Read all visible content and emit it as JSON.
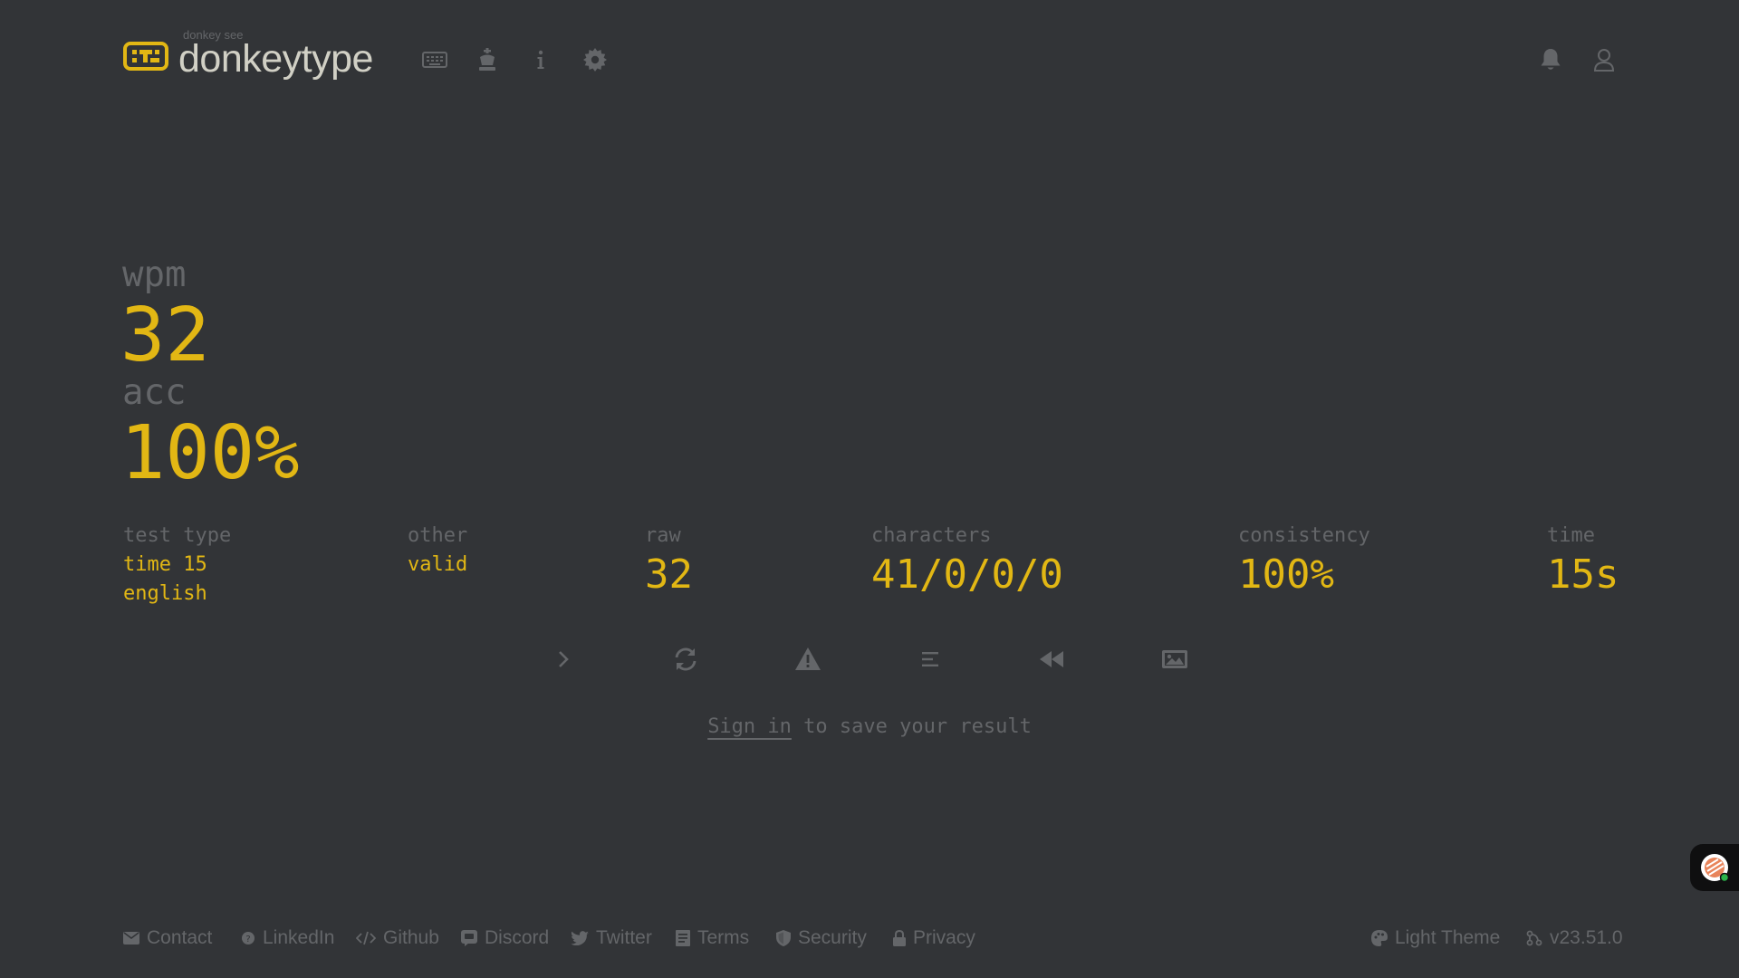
{
  "header": {
    "logo_top": "donkey see",
    "logo_text": "donkeytype",
    "nav": [
      "keyboard-icon",
      "crown-icon",
      "info-icon",
      "settings-icon"
    ],
    "right": [
      "bell-icon",
      "user-icon"
    ]
  },
  "result": {
    "wpm_label": "wpm",
    "wpm_value": "32",
    "acc_label": "acc",
    "acc_value": "100%",
    "test_type_label": "test type",
    "test_type_line1": "time 15",
    "test_type_line2": "english",
    "other_label": "other",
    "other_value": "valid",
    "raw_label": "raw",
    "raw_value": "32",
    "characters_label": "characters",
    "characters_value": "41/0/0/0",
    "consistency_label": "consistency",
    "consistency_value": "100%",
    "time_label": "time",
    "time_value": "15s"
  },
  "actions": [
    "next-test-icon",
    "restart-icon",
    "warning-icon",
    "words-history-icon",
    "replay-icon",
    "screenshot-icon"
  ],
  "signin": {
    "link": "Sign in",
    "rest": " to save your result"
  },
  "footer": {
    "contact": "Contact",
    "linkedin": "LinkedIn",
    "github": "Github",
    "discord": "Discord",
    "twitter": "Twitter",
    "terms": "Terms",
    "security": "Security",
    "privacy": "Privacy",
    "theme": "Light Theme",
    "version": "v23.51.0"
  },
  "colors": {
    "background": "#323437",
    "main": "#e2b714",
    "sub": "#646669",
    "text": "#d1d0c5"
  }
}
